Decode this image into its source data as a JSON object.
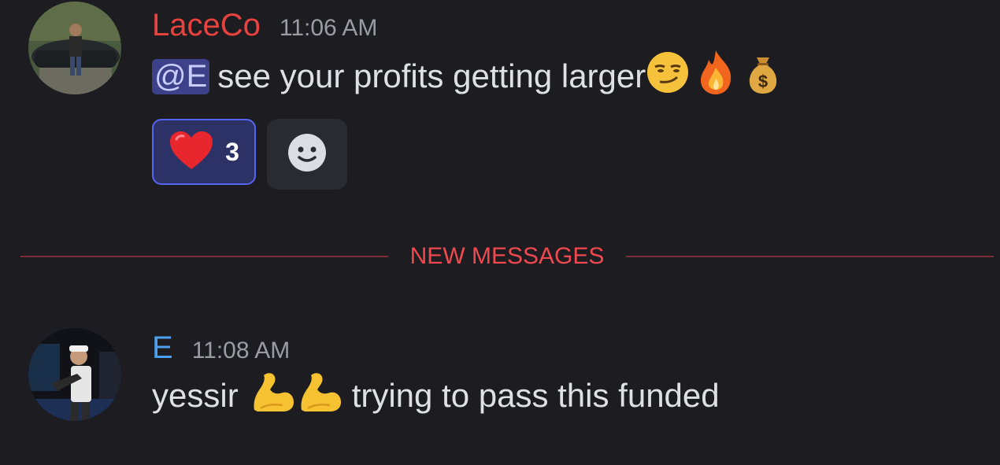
{
  "messages": [
    {
      "author": "LaceCo",
      "author_color": "#e8423f",
      "timestamp": "11:06 AM",
      "mention": "@E",
      "text": "see your profits getting larger",
      "emojis": [
        "smirk-emoji",
        "fire-emoji",
        "money-bag-emoji"
      ],
      "reactions": [
        {
          "emoji": "red-heart-emoji",
          "count": "3",
          "active": true
        }
      ]
    },
    {
      "author": "E",
      "author_color": "#4a9ff0",
      "timestamp": "11:08 AM",
      "text_before": "yessir",
      "emojis": [
        "flexed-biceps-emoji",
        "flexed-biceps-emoji"
      ],
      "text_after": "trying to pass this funded"
    }
  ],
  "divider": {
    "label": "NEW MESSAGES",
    "color": "#f0484f"
  }
}
